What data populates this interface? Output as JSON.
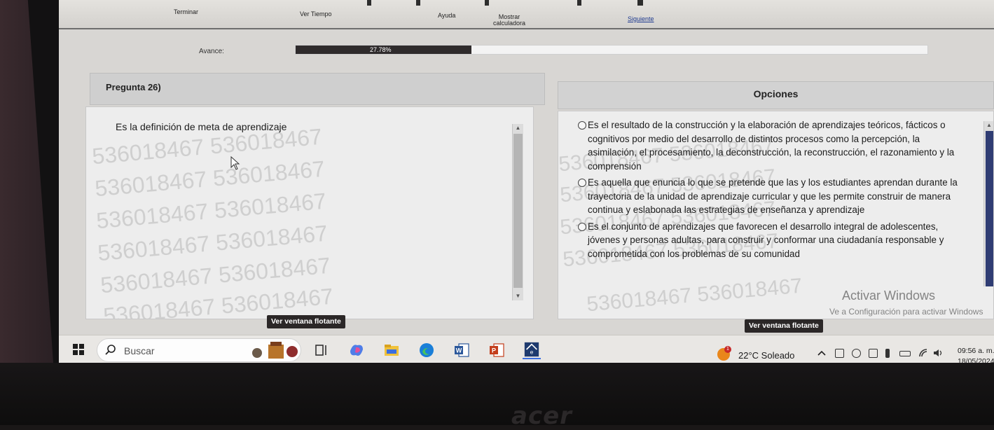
{
  "toolbar": {
    "terminate": "Terminar",
    "view_time": "Ver Tiempo",
    "help": "Ayuda",
    "calculator_line1": "Mostrar",
    "calculator_line2": "calculadora",
    "next": "Siguiente"
  },
  "progress": {
    "label": "Avance:",
    "value_text": "27.78%",
    "fraction": 0.2778
  },
  "question": {
    "header": "Pregunta 26)",
    "text": "Es la definición de meta de aprendizaje"
  },
  "options_panel": {
    "header": "Opciones",
    "options": [
      "Es el resultado de la construcción y la elaboración de aprendizajes teóricos, fácticos o cognitivos por medio del desarrollo de distintos procesos como la percepción, la asimilación, el procesamiento, la deconstrucción, la reconstrucción, el razonamiento y la comprensión",
      "Es aquella que enuncia lo que se pretende que las y los estudiantes aprendan durante la trayectoria de la unidad de aprendizaje curricular y que les permite construir de manera continua y eslabonada las estrategias de enseñanza y aprendizaje",
      "Es el conjunto de aprendizajes que favorecen el desarrollo integral de adolescentes, jóvenes y personas adultas, para construir y conformar una ciudadanía responsable y comprometida con los problemas de su comunidad"
    ]
  },
  "watermark": {
    "text": "536018467 536018467",
    "single": "536018467"
  },
  "floating_buttons": {
    "left": "Ver ventana flotante",
    "right": "Ver ventana flotante"
  },
  "windows_activation": {
    "title": "Activar Windows",
    "subtitle": "Ve a Configuración para activar Windows"
  },
  "taskbar": {
    "search_placeholder": "Buscar",
    "weather_temp": "22°C",
    "weather_desc": "Soleado",
    "weather_alert": "1",
    "time": "09:56 a. m.",
    "date": "18/05/2024"
  },
  "device_brand": "acer",
  "colors": {
    "progress_fill": "#2f2b2c",
    "scroll_thumb_active": "#2f3c73",
    "float_button": "#2b2727",
    "next_link": "#1e3a8f"
  }
}
